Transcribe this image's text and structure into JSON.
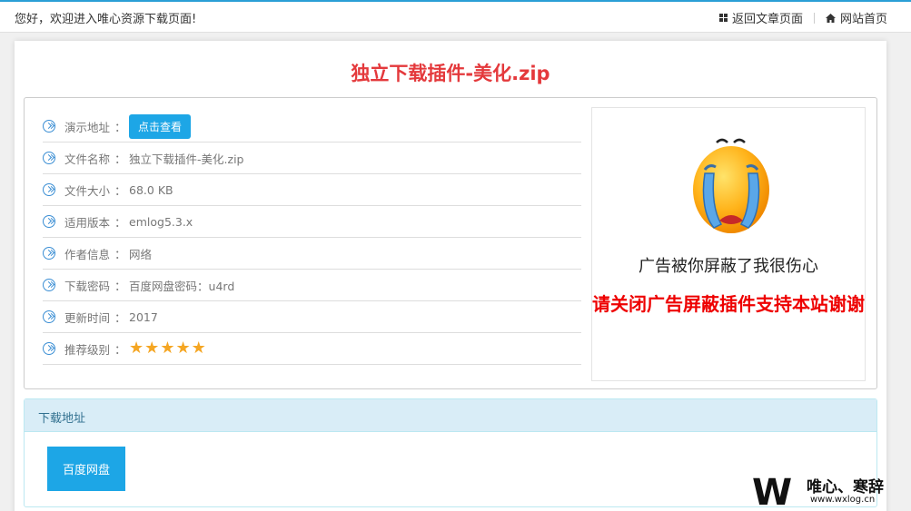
{
  "topbar": {
    "welcome": "您好，欢迎进入唯心资源下载页面!",
    "back_link": "返回文章页面",
    "home_link": "网站首页"
  },
  "title": "独立下载插件-美化.zip",
  "info": {
    "rows": [
      {
        "label": "演示地址",
        "value": "",
        "button": "点击查看"
      },
      {
        "label": "文件名称",
        "value": "独立下载插件-美化.zip"
      },
      {
        "label": "文件大小",
        "value": "68.0 KB"
      },
      {
        "label": "适用版本",
        "value": "emlog5.3.x"
      },
      {
        "label": "作者信息",
        "value": "网络"
      },
      {
        "label": "下载密码",
        "value": "百度网盘密码：u4rd"
      },
      {
        "label": "更新时间",
        "value": "2017"
      },
      {
        "label": "推荐级别",
        "value": "",
        "rating": 5,
        "rating_max": 5
      }
    ]
  },
  "ad": {
    "line1": "广告被你屏蔽了我很伤心",
    "line2": "请关闭广告屏蔽插件支持本站谢谢"
  },
  "download": {
    "heading": "下载地址",
    "button": "百度网盘"
  },
  "watermark": {
    "logo_letter": "W",
    "text": "唯心、寒辞",
    "url": "www.wxlog.cn"
  },
  "colors": {
    "accent": "#1da6e6",
    "title": "#e4393c",
    "icon": "#3a8ed4",
    "star": "#f5a623",
    "ad_warning": "#ee0000"
  }
}
